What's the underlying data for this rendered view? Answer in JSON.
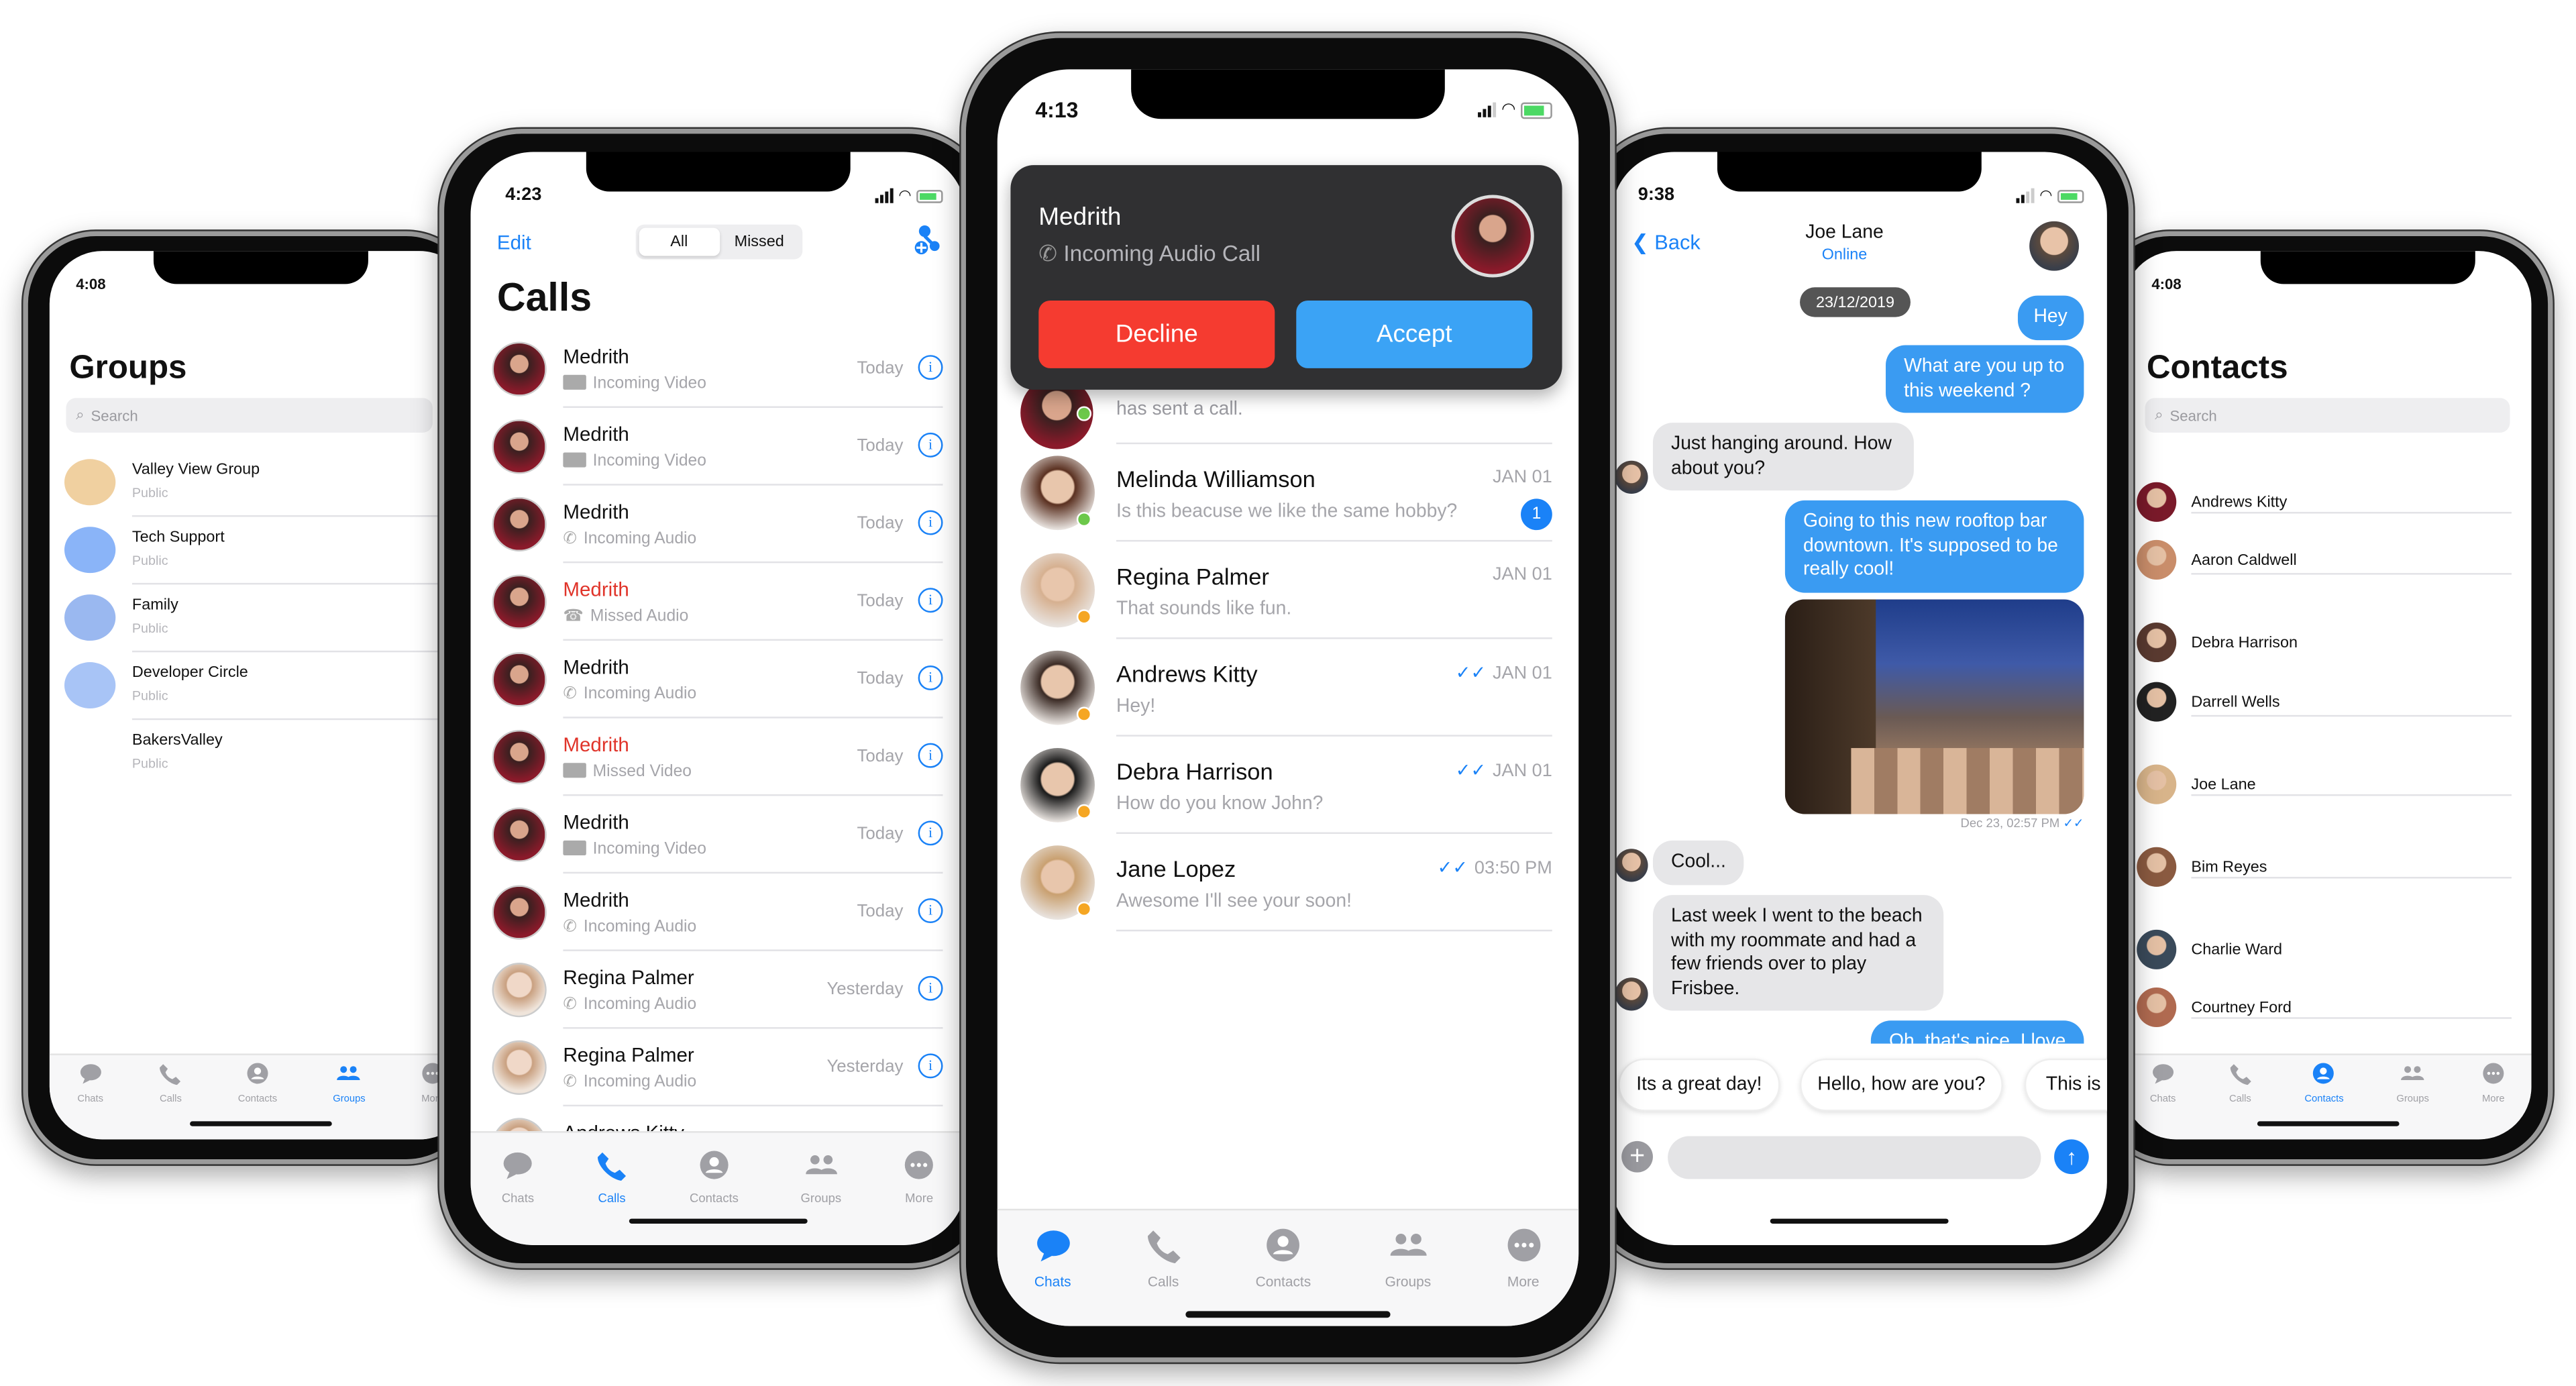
{
  "colors": {
    "accent": "#1a82f7",
    "bubble_out": "#3a9bf2",
    "decline": "#f53b30",
    "accept": "#3ba3f5",
    "missed": "#e0342a",
    "online": "#6cc84a",
    "away": "#f5a623"
  },
  "tabs": [
    "Chats",
    "Calls",
    "Contacts",
    "Groups",
    "More"
  ],
  "tab_icons": [
    "chat-bubble-icon",
    "phone-icon",
    "contact-icon",
    "groups-icon",
    "more-icon"
  ],
  "groups_screen": {
    "time": "4:08",
    "title": "Groups",
    "search_placeholder": "Search",
    "active_tab": 3,
    "items": [
      {
        "name": "Valley View Group",
        "sub": "Public"
      },
      {
        "name": "Tech Support",
        "sub": "Public"
      },
      {
        "name": "Family",
        "sub": "Public"
      },
      {
        "name": "Developer Circle",
        "sub": "Public"
      },
      {
        "name": "BakersValley",
        "sub": "Public"
      }
    ]
  },
  "calls_screen": {
    "time": "4:23",
    "edit": "Edit",
    "segments": [
      "All",
      "Missed"
    ],
    "selected_segment": "All",
    "title": "Calls",
    "active_tab": 1,
    "items": [
      {
        "name": "Medrith",
        "type": "Incoming Video",
        "when": "Today",
        "missed": false,
        "icon": "video"
      },
      {
        "name": "Medrith",
        "type": "Incoming Video",
        "when": "Today",
        "missed": false,
        "icon": "video"
      },
      {
        "name": "Medrith",
        "type": "Incoming Audio",
        "when": "Today",
        "missed": false,
        "icon": "audio"
      },
      {
        "name": "Medrith",
        "type": "Missed Audio",
        "when": "Today",
        "missed": true,
        "icon": "missed-audio"
      },
      {
        "name": "Medrith",
        "type": "Incoming Audio",
        "when": "Today",
        "missed": false,
        "icon": "audio"
      },
      {
        "name": "Medrith",
        "type": "Missed Video",
        "when": "Today",
        "missed": true,
        "icon": "video"
      },
      {
        "name": "Medrith",
        "type": "Incoming Video",
        "when": "Today",
        "missed": false,
        "icon": "video"
      },
      {
        "name": "Medrith",
        "type": "Incoming Audio",
        "when": "Today",
        "missed": false,
        "icon": "audio"
      },
      {
        "name": "Regina Palmer",
        "type": "Incoming Audio",
        "when": "Yesterday",
        "missed": false,
        "icon": "audio"
      },
      {
        "name": "Regina Palmer",
        "type": "Incoming Audio",
        "when": "Yesterday",
        "missed": false,
        "icon": "audio"
      },
      {
        "name": "Andrews Kitty",
        "type": "",
        "when": "",
        "missed": false,
        "icon": ""
      }
    ]
  },
  "chats_screen": {
    "time": "4:13",
    "active_tab": 0,
    "call_card": {
      "name": "Medrith",
      "subtitle": "Incoming Audio Call",
      "decline": "Decline",
      "accept": "Accept"
    },
    "partial_row": "has sent a call.",
    "items": [
      {
        "name": "Melinda Williamson",
        "msg": "Is this beacuse we like the same hobby?",
        "date": "JAN 01",
        "badge": "1",
        "read": false,
        "status": "online"
      },
      {
        "name": "Regina Palmer",
        "msg": "That sounds like fun.",
        "date": "JAN 01",
        "badge": "",
        "read": false,
        "status": "away"
      },
      {
        "name": "Andrews Kitty",
        "msg": "Hey!",
        "date": "JAN 01",
        "badge": "",
        "read": true,
        "status": "away"
      },
      {
        "name": "Debra Harrison",
        "msg": "How do you know John?",
        "date": "JAN 01",
        "badge": "",
        "read": true,
        "status": "away"
      },
      {
        "name": "Jane Lopez",
        "msg": "Awesome I'll see your soon!",
        "date": "03:50 PM",
        "badge": "",
        "read": true,
        "status": "away"
      }
    ]
  },
  "conversation_screen": {
    "time": "9:38",
    "back": "Back",
    "contact": "Joe Lane",
    "presence": "Online",
    "date_pill": "23/12/2019",
    "messages": {
      "m1": "Hey",
      "m2": "What are you up to this weekend ?",
      "m3": "Just hanging around. How about you?",
      "m4": "Going to this new rooftop bar downtown. It's supposed to be really cool!",
      "image_time": "Dec 23, 02:57 PM",
      "m5": "Cool...",
      "m6": "Last week I went to the beach with my roommate and had a few friends over to play Frisbee.",
      "m7": "Oh, that's nice. I love"
    },
    "quick_replies": [
      "Its a great day!",
      "Hello, how are you?",
      "This is"
    ],
    "input_value": ""
  },
  "contacts_screen": {
    "time": "4:08",
    "title": "Contacts",
    "search_placeholder": "Search",
    "active_tab": 2,
    "items": [
      "Andrews Kitty",
      "Aaron Caldwell",
      "Debra Harrison",
      "Darrell Wells",
      "Joe Lane",
      "Bim Reyes",
      "Charlie Ward",
      "Courtney Ford"
    ]
  }
}
